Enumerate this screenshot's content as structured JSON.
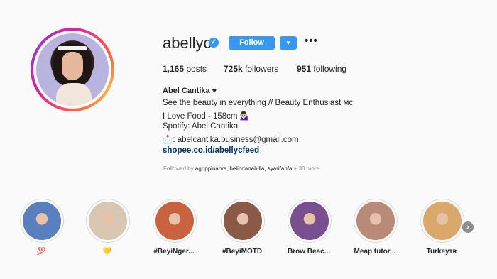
{
  "profile": {
    "username": "abellyc",
    "follow_label": "Follow",
    "more_label": "•••",
    "posts_count": "1,165",
    "posts_label": "posts",
    "followers_count": "725k",
    "followers_label": "followers",
    "following_count": "951",
    "following_label": "following",
    "full_name": "Abel Cantika ♥",
    "bio": [
      "See the beauty in everything // Beauty Enthusiast ᴍᴄ",
      "I Love Food - 158cm 💁🏻‍♀️",
      "Spotify: Abel Cantika",
      "📩: abelcantika.business@gmail.com"
    ],
    "link": "shopee.co.id/abellycfeed",
    "followed_by_prefix": "Followed by",
    "followed_by_names": "agrippinahrs, belindanabilla, syarifahfa",
    "followed_by_suffix": "+ 30 more"
  },
  "highlights": [
    {
      "label": "💯",
      "color": "#5a7fbf"
    },
    {
      "label": "💛",
      "color": "#d9c7b3"
    },
    {
      "label": "#BeyiNger...",
      "color": "#c9633f"
    },
    {
      "label": "#BeyiMOTD",
      "color": "#8a5a46"
    },
    {
      "label": "Brow Beac...",
      "color": "#7a4f8f"
    },
    {
      "label": "Meap tutor...",
      "color": "#b98a78"
    },
    {
      "label": "Turkeyᴛʀ",
      "color": "#d9a86a"
    }
  ],
  "colors": {
    "accent": "#3897f0",
    "link": "#003569",
    "muted": "#8e8e8e"
  },
  "icons": {
    "verified": "verified-badge-icon",
    "dropdown": "chevron-down-icon",
    "next": "chevron-right-icon"
  }
}
